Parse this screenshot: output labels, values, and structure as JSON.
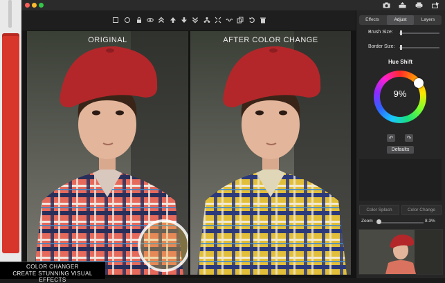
{
  "window": {
    "lights": [
      "#fc5f57",
      "#fdbc2e",
      "#33c748"
    ]
  },
  "titlebar_icons": [
    "camera-icon",
    "upload-icon",
    "printer-icon",
    "share-icon"
  ],
  "toolbar": {
    "tools": [
      "crop-icon",
      "adjust-icon",
      "lock-icon",
      "eye-icon",
      "move-up-icon",
      "move-up-one-icon",
      "move-down-one-icon",
      "move-down-icon",
      "tree-icon",
      "shrink-icon",
      "wave-icon",
      "copy-icon",
      "undo-icon",
      "trash-icon"
    ]
  },
  "canvas": {
    "left_label": "ORIGINAL",
    "right_label": "AFTER COLOR CHANGE"
  },
  "panel": {
    "tabs": [
      {
        "label": "Effects",
        "selected": false
      },
      {
        "label": "Adjust",
        "selected": true
      },
      {
        "label": "Layers",
        "selected": false
      }
    ],
    "brush_size_label": "Brush Size:",
    "border_size_label": "Border Size:",
    "brush_size_level": 0.02,
    "border_size_level": 0.02,
    "hue_shift_title": "Hue Shift",
    "hue_value": "9%",
    "defaults_label": "Defaults",
    "color_splash_label": "Color Splash",
    "color_change_label": "Color Change",
    "zoom_label": "Zoom",
    "zoom_value": "8.3%"
  },
  "caption": {
    "line1": "COLOR CHANGER",
    "line2": "CREATE STUNNING VISUAL EFFECTS"
  },
  "colors": {
    "accent_red": "#d8352b",
    "panel_bg": "#262627",
    "canvas_bg": "#141414"
  }
}
